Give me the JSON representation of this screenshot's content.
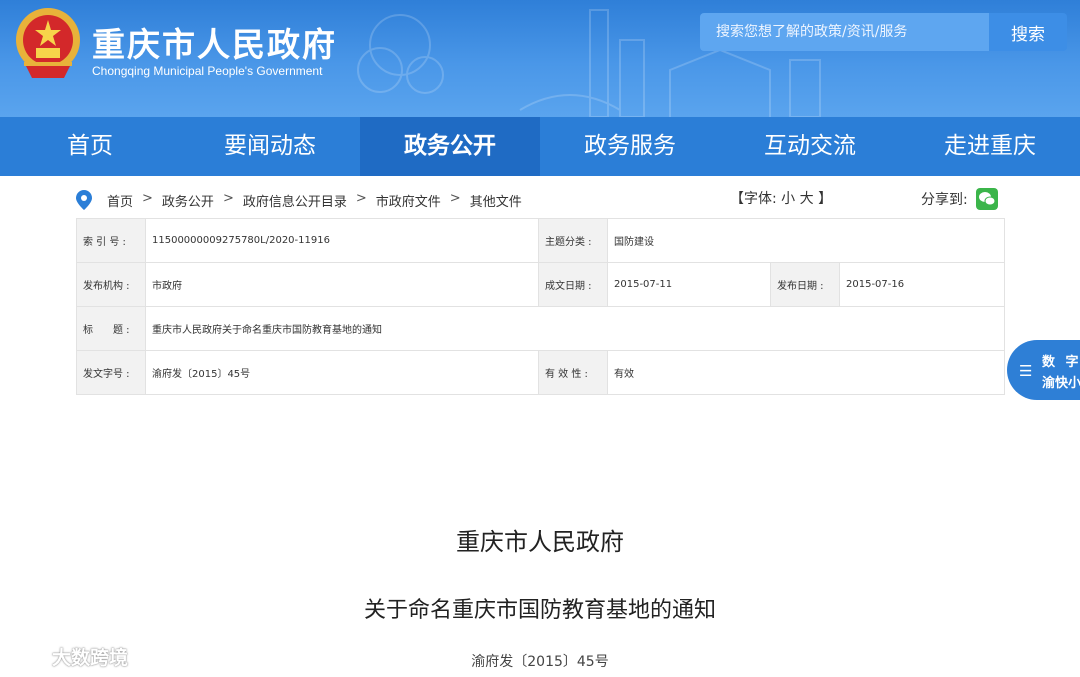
{
  "header": {
    "title": "重庆市人民政府",
    "subtitle": "Chongqing Municipal People's Government",
    "search_placeholder": "搜索您想了解的政策/资讯/服务",
    "search_button": "搜索"
  },
  "nav": {
    "items": [
      {
        "label": "首页"
      },
      {
        "label": "要闻动态"
      },
      {
        "label": "政务公开"
      },
      {
        "label": "政务服务"
      },
      {
        "label": "互动交流"
      },
      {
        "label": "走进重庆"
      }
    ],
    "active": "政务公开"
  },
  "breadcrumb": [
    "首页",
    "政务公开",
    "政府信息公开目录",
    "市政府文件",
    "其他文件"
  ],
  "breadcrumb_sep": ">",
  "font_ctl": {
    "open": "【字体:",
    "small": "小",
    "large": "大",
    "close": "】"
  },
  "share_label": "分享到:",
  "meta": {
    "index_label": "索 引 号 :",
    "index_value": "11500000009275780L/2020-11916",
    "topic_label": "主题分类 :",
    "topic_value": "国防建设",
    "issuer_label": "发布机构 :",
    "issuer_value": "市政府",
    "written_label": "成文日期 :",
    "written_value": "2015-07-11",
    "publish_label": "发布日期 :",
    "publish_value": "2015-07-16",
    "title_label": "标　　题 :",
    "title_value": "重庆市人民政府关于命名重庆市国防教育基地的通知",
    "docno_label": "发文字号 :",
    "docno_value": "渝府发〔2015〕45号",
    "validity_label": "有 效 性 :",
    "validity_value": "有效"
  },
  "side_tab": {
    "line1": "数 字",
    "line2": "渝快小"
  },
  "document": {
    "org": "重庆市人民政府",
    "title": "关于命名重庆市国防教育基地的通知",
    "doc_no": "渝府发〔2015〕45号"
  },
  "watermark": "大数跨境",
  "colors": {
    "header_blue": "#4a97e8",
    "nav_blue": "#2b7ed7",
    "nav_active": "#1f6bc4",
    "wechat_green": "#3bb54a"
  }
}
